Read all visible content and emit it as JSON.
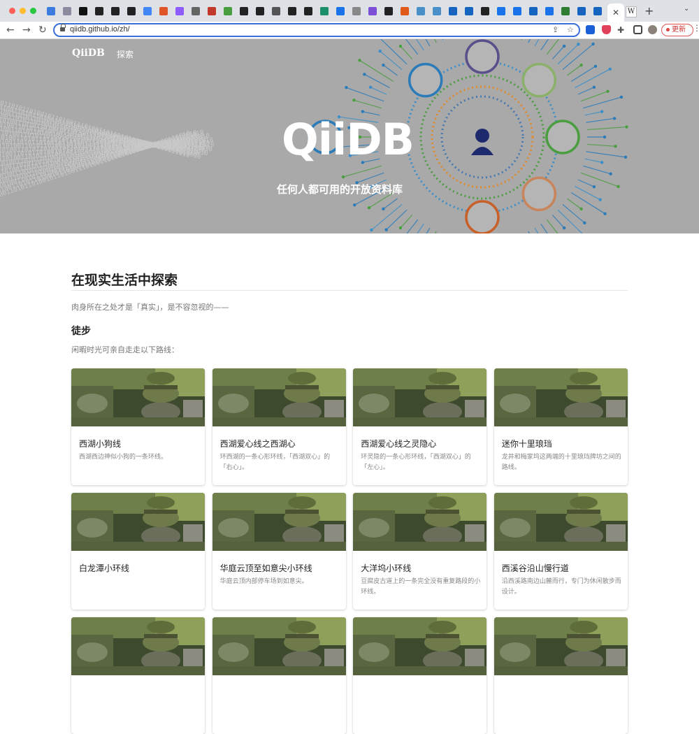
{
  "browser": {
    "url": "qiidb.github.io/zh/",
    "update_label": "更新",
    "active_tab_close": "✕",
    "new_tab": "+",
    "tab_icons": [
      "#3d7be0",
      "#8a8aa0",
      "#111111",
      "#222222",
      "#222222",
      "#222222",
      "#4285f4",
      "#e0552a",
      "#8f5cff",
      "#666666",
      "#c0392b",
      "#4a9e3f",
      "#222222",
      "#222222",
      "#555555",
      "#222222",
      "#222222",
      "#1d8f6b",
      "#1a73e8",
      "#888888",
      "#7b4fd6",
      "#222222",
      "#e05a1a",
      "#4a90c8",
      "#4a90c8",
      "#1565c0",
      "#1565c0",
      "#222222",
      "#1a73e8",
      "#1a73e8",
      "#1565c0",
      "#1a73e8",
      "#2e7d32",
      "#1565c0",
      "#1565c0"
    ]
  },
  "site": {
    "logo": "QiiDB",
    "nav_explore": "探索",
    "hero_title": "QiiDB",
    "hero_subtitle": "任何人都可用的开放资料库"
  },
  "section": {
    "title": "在现实生活中探索",
    "lead": "肉身所在之处才是「真实」，是不容忽视的——",
    "sub_title": "徒步",
    "sub_lead": "闲暇时光可亲自走走以下路线："
  },
  "cards": [
    {
      "title": "西湖小狗线",
      "desc": "西湖西边神似小狗的一条环线。"
    },
    {
      "title": "西湖爱心线之西湖心",
      "desc": "环西湖的一条心形环线，「西湖双心」的「右心」。"
    },
    {
      "title": "西湖爱心线之灵隐心",
      "desc": "环灵隐的一条心形环线，「西湖双心」的「左心」。"
    },
    {
      "title": "迷你十里琅珰",
      "desc": "龙井和梅家坞这两端的十里琅珰牌坊之间的路线。"
    },
    {
      "title": "白龙潭小环线",
      "desc": ""
    },
    {
      "title": "华庭云顶至如意尖小环线",
      "desc": "华庭云顶内部停车场到如意尖。"
    },
    {
      "title": "大洋坞小环线",
      "desc": "豆腐皮古道上的一条完全没有重复路段的小环线。"
    },
    {
      "title": "西溪谷沿山慢行道",
      "desc": "沿西溪路南边山麓而行，专门为休闲散步而设计。"
    },
    {
      "title": "",
      "desc": ""
    },
    {
      "title": "",
      "desc": ""
    },
    {
      "title": "",
      "desc": ""
    },
    {
      "title": "",
      "desc": ""
    }
  ]
}
